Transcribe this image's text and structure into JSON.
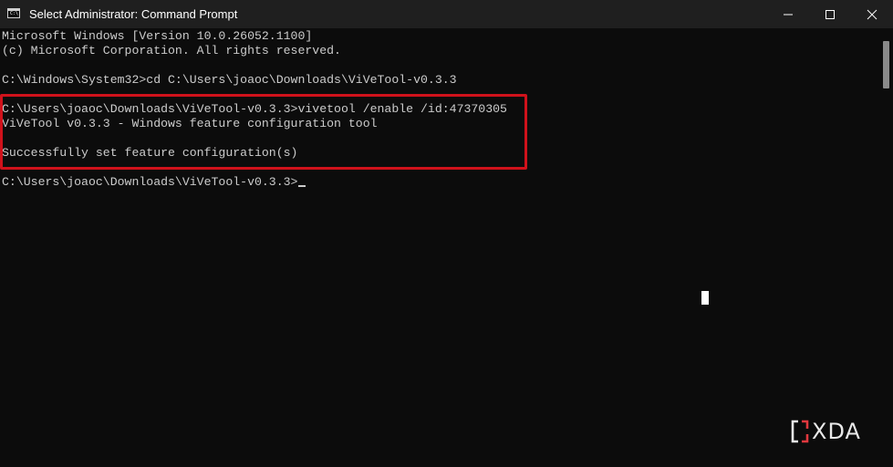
{
  "window": {
    "title": "Select Administrator: Command Prompt",
    "icon": "cmd-icon",
    "icon_glyph": "C:\\"
  },
  "controls": {
    "minimize_icon": "minimize-icon",
    "maximize_icon": "maximize-icon",
    "close_icon": "close-icon"
  },
  "terminal": {
    "lines": [
      "Microsoft Windows [Version 10.0.26052.1100]",
      "(c) Microsoft Corporation. All rights reserved.",
      "",
      "C:\\Windows\\System32>cd C:\\Users\\joaoc\\Downloads\\ViVeTool-v0.3.3",
      "",
      "C:\\Users\\joaoc\\Downloads\\ViVeTool-v0.3.3>vivetool /enable /id:47370305",
      "ViVeTool v0.3.3 - Windows feature configuration tool",
      "",
      "Successfully set feature configuration(s)",
      "",
      "C:\\Users\\joaoc\\Downloads\\ViVeTool-v0.3.3>"
    ]
  },
  "watermark": {
    "text": "XDA"
  },
  "colors": {
    "background": "#0c0c0c",
    "titlebar": "#1f1f1f",
    "text": "#cccccc",
    "highlight": "#d0121b",
    "watermark_accent": "#e0383e"
  }
}
